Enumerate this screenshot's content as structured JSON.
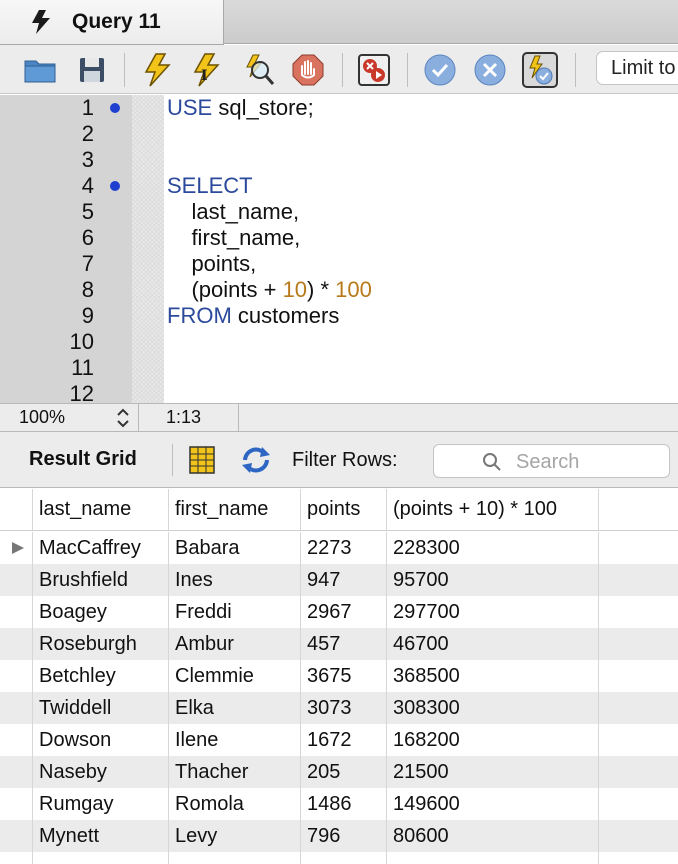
{
  "tab": {
    "title": "Query 11",
    "icon": "lightning-icon"
  },
  "toolbar": {
    "buttons": [
      {
        "name": "open-folder-icon"
      },
      {
        "name": "save-icon"
      },
      {
        "name": "execute-icon"
      },
      {
        "name": "execute-current-icon"
      },
      {
        "name": "explain-icon"
      },
      {
        "name": "stop-icon"
      },
      {
        "name": "toggle-error-stop-icon"
      },
      {
        "name": "commit-icon"
      },
      {
        "name": "rollback-icon"
      },
      {
        "name": "autocommit-icon"
      }
    ],
    "limit_label": "Limit to"
  },
  "editor": {
    "lines": [
      {
        "number": "1",
        "marker": true
      },
      {
        "number": "2",
        "marker": false
      },
      {
        "number": "3",
        "marker": false
      },
      {
        "number": "4",
        "marker": true
      },
      {
        "number": "5",
        "marker": false
      },
      {
        "number": "6",
        "marker": false
      },
      {
        "number": "7",
        "marker": false
      },
      {
        "number": "8",
        "marker": false
      },
      {
        "number": "9",
        "marker": false
      },
      {
        "number": "10",
        "marker": false
      },
      {
        "number": "11",
        "marker": false
      },
      {
        "number": "12",
        "marker": false
      }
    ],
    "code": {
      "l1_kw": "USE",
      "l1_rest": " sql_store;",
      "l4_kw": "SELECT",
      "l5": "    last_name,",
      "l6": "    first_name,",
      "l7": "    points,",
      "l8_a": "    (points + ",
      "l8_num1": "10",
      "l8_b": ") * ",
      "l8_num2": "100",
      "l9_kw": "FROM",
      "l9_rest": " customers"
    }
  },
  "status": {
    "zoom": "100%",
    "position": "1:13"
  },
  "results": {
    "label": "Result Grid",
    "filter_label": "Filter Rows:",
    "search_placeholder": "Search",
    "columns": [
      "last_name",
      "first_name",
      "points",
      "(points + 10) * 100"
    ],
    "rows": [
      [
        "MacCaffrey",
        "Babara",
        "2273",
        "228300"
      ],
      [
        "Brushfield",
        "Ines",
        "947",
        "95700"
      ],
      [
        "Boagey",
        "Freddi",
        "2967",
        "297700"
      ],
      [
        "Roseburgh",
        "Ambur",
        "457",
        "46700"
      ],
      [
        "Betchley",
        "Clemmie",
        "3675",
        "368500"
      ],
      [
        "Twiddell",
        "Elka",
        "3073",
        "308300"
      ],
      [
        "Dowson",
        "Ilene",
        "1672",
        "168200"
      ],
      [
        "Naseby",
        "Thacher",
        "205",
        "21500"
      ],
      [
        "Rumgay",
        "Romola",
        "1486",
        "149600"
      ],
      [
        "Mynett",
        "Levy",
        "796",
        "80600"
      ]
    ]
  }
}
